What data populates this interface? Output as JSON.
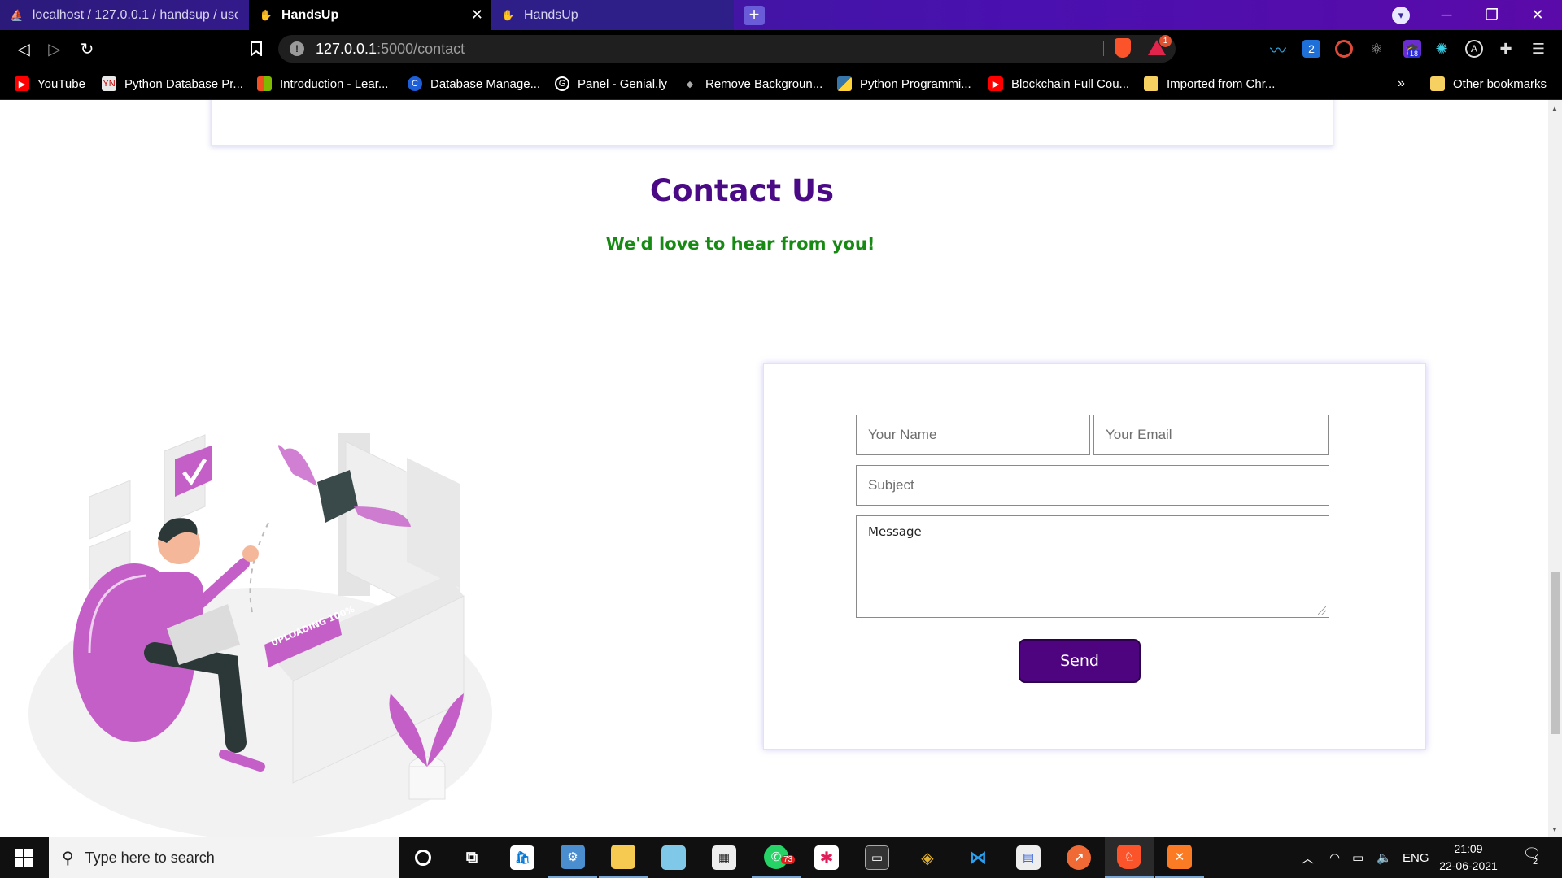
{
  "browser": {
    "tabs": [
      {
        "title": "localhost / 127.0.0.1 / handsup / users",
        "active": false
      },
      {
        "title": "HandsUp",
        "active": true
      },
      {
        "title": "HandsUp",
        "active": false
      }
    ],
    "new_tab_glyph": "+",
    "address": {
      "host": "127.0.0.1",
      "path": ":5000/contact"
    },
    "rewards_badge": "1",
    "extension_badge": "18",
    "bookmarks": [
      "YouTube",
      "Python Database Pr...",
      "Introduction - Lear...",
      "Database Manage...",
      "Panel - Genial.ly",
      "Remove Backgroun...",
      "Python Programmi...",
      "Blockchain Full Cou...",
      "Imported from Chr..."
    ],
    "bookmarks_overflow": "»",
    "other_bookmarks": "Other bookmarks"
  },
  "page": {
    "title": "Contact Us",
    "subtitle": "We'd love to hear from you!",
    "illustration_text": "UPLOADING 100%",
    "form": {
      "name_placeholder": "Your Name",
      "email_placeholder": "Your Email",
      "subject_placeholder": "Subject",
      "message_placeholder": "Message",
      "send_label": "Send"
    }
  },
  "taskbar": {
    "search_placeholder": "Type here to search",
    "whatsapp_badge": "73",
    "language": "ENG",
    "time": "21:09",
    "date": "22-06-2021",
    "notification_count": "2"
  },
  "colors": {
    "title": "#4b0a85",
    "subtitle": "#178a14",
    "send_button": "#4f047f",
    "illustration_accent": "#c55fc8"
  }
}
